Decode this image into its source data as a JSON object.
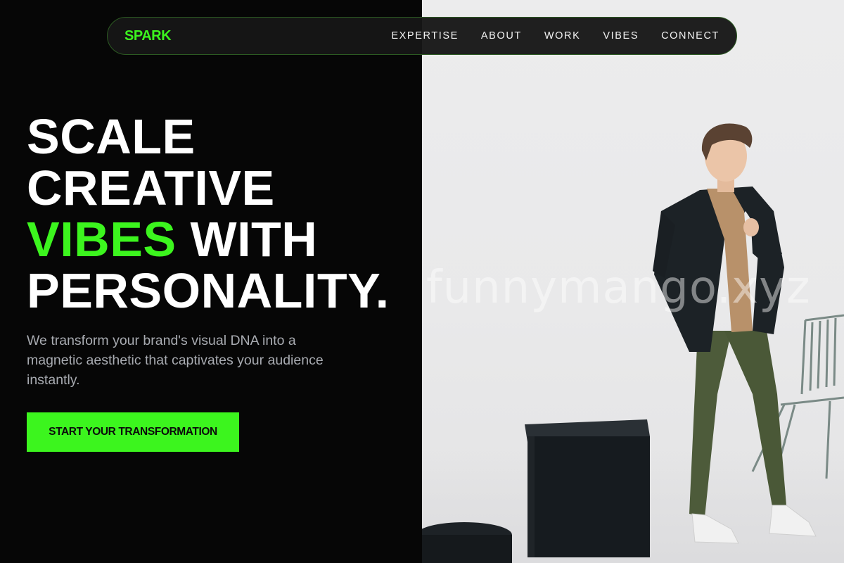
{
  "brand": {
    "logo": "SPARK",
    "accent_color": "#3cf51e"
  },
  "nav": {
    "links": [
      "EXPERTISE",
      "ABOUT",
      "WORK",
      "VIBES",
      "CONNECT"
    ]
  },
  "hero": {
    "line1": "SCALE",
    "line2": "CREATIVE",
    "line3_accent": "VIBES",
    "line3_rest": " WITH",
    "line4": "PERSONALITY.",
    "subtext": "We transform your brand's visual DNA into a magnetic aesthetic that captivates your audience instantly.",
    "cta_label": "START YOUR TRANSFORMATION"
  },
  "photo": {
    "watermark": "funnymango.xyz",
    "icon": "person-standing-photo"
  }
}
